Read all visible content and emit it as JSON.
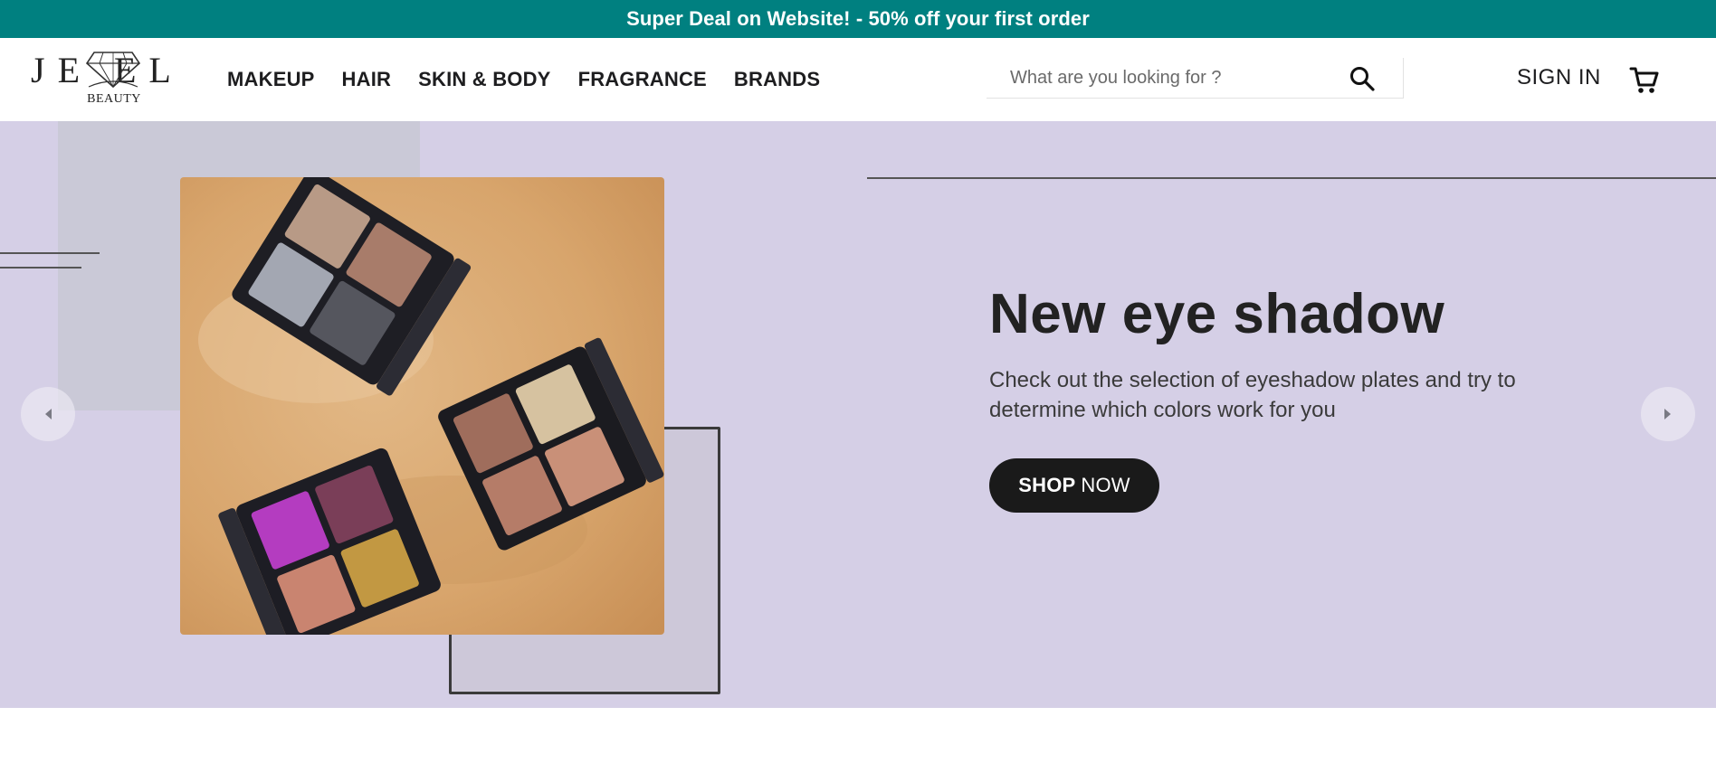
{
  "promo_bar": {
    "text": "Super Deal on Website! - 50% off your first order"
  },
  "logo": {
    "wordmark": "JE EL",
    "subtitle": "BEAUTY"
  },
  "nav": {
    "items": [
      "MAKEUP",
      "HAIR",
      "SKIN & BODY",
      "FRAGRANCE",
      "BRANDS"
    ]
  },
  "search": {
    "placeholder": "What are you looking for ?",
    "value": ""
  },
  "account": {
    "sign_in_label": "SIGN IN"
  },
  "hero": {
    "title": "New eye shadow",
    "description": "Check out the selection of eyeshadow plates and try to determine which colors work for you",
    "cta_bold": "SHOP",
    "cta_rest": "NOW",
    "background_color": "#d5cfe6"
  },
  "colors": {
    "promo_bar": "#008080",
    "cta_button": "#1a1a1a"
  },
  "icons": [
    "search-icon",
    "cart-icon",
    "chevron-left-icon",
    "chevron-right-icon",
    "diamond-icon"
  ]
}
